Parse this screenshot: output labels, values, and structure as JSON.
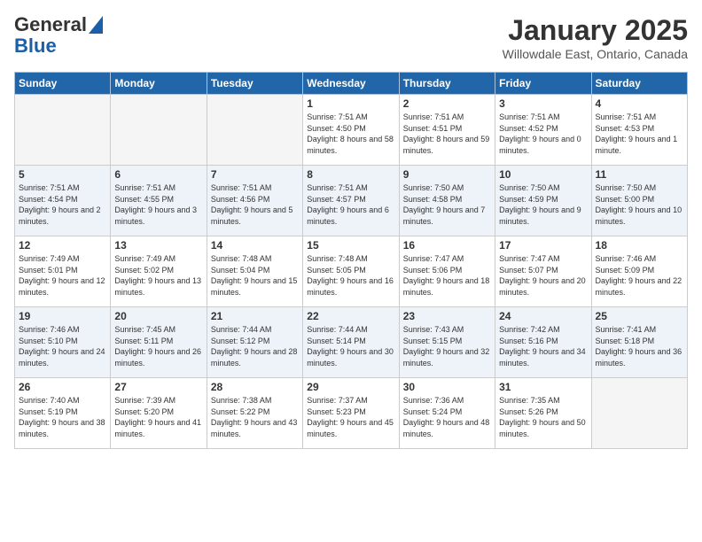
{
  "header": {
    "logo_general": "General",
    "logo_blue": "Blue",
    "month": "January 2025",
    "location": "Willowdale East, Ontario, Canada"
  },
  "days_of_week": [
    "Sunday",
    "Monday",
    "Tuesday",
    "Wednesday",
    "Thursday",
    "Friday",
    "Saturday"
  ],
  "weeks": [
    [
      {
        "day": "",
        "info": ""
      },
      {
        "day": "",
        "info": ""
      },
      {
        "day": "",
        "info": ""
      },
      {
        "day": "1",
        "info": "Sunrise: 7:51 AM\nSunset: 4:50 PM\nDaylight: 8 hours and 58 minutes."
      },
      {
        "day": "2",
        "info": "Sunrise: 7:51 AM\nSunset: 4:51 PM\nDaylight: 8 hours and 59 minutes."
      },
      {
        "day": "3",
        "info": "Sunrise: 7:51 AM\nSunset: 4:52 PM\nDaylight: 9 hours and 0 minutes."
      },
      {
        "day": "4",
        "info": "Sunrise: 7:51 AM\nSunset: 4:53 PM\nDaylight: 9 hours and 1 minute."
      }
    ],
    [
      {
        "day": "5",
        "info": "Sunrise: 7:51 AM\nSunset: 4:54 PM\nDaylight: 9 hours and 2 minutes."
      },
      {
        "day": "6",
        "info": "Sunrise: 7:51 AM\nSunset: 4:55 PM\nDaylight: 9 hours and 3 minutes."
      },
      {
        "day": "7",
        "info": "Sunrise: 7:51 AM\nSunset: 4:56 PM\nDaylight: 9 hours and 5 minutes."
      },
      {
        "day": "8",
        "info": "Sunrise: 7:51 AM\nSunset: 4:57 PM\nDaylight: 9 hours and 6 minutes."
      },
      {
        "day": "9",
        "info": "Sunrise: 7:50 AM\nSunset: 4:58 PM\nDaylight: 9 hours and 7 minutes."
      },
      {
        "day": "10",
        "info": "Sunrise: 7:50 AM\nSunset: 4:59 PM\nDaylight: 9 hours and 9 minutes."
      },
      {
        "day": "11",
        "info": "Sunrise: 7:50 AM\nSunset: 5:00 PM\nDaylight: 9 hours and 10 minutes."
      }
    ],
    [
      {
        "day": "12",
        "info": "Sunrise: 7:49 AM\nSunset: 5:01 PM\nDaylight: 9 hours and 12 minutes."
      },
      {
        "day": "13",
        "info": "Sunrise: 7:49 AM\nSunset: 5:02 PM\nDaylight: 9 hours and 13 minutes."
      },
      {
        "day": "14",
        "info": "Sunrise: 7:48 AM\nSunset: 5:04 PM\nDaylight: 9 hours and 15 minutes."
      },
      {
        "day": "15",
        "info": "Sunrise: 7:48 AM\nSunset: 5:05 PM\nDaylight: 9 hours and 16 minutes."
      },
      {
        "day": "16",
        "info": "Sunrise: 7:47 AM\nSunset: 5:06 PM\nDaylight: 9 hours and 18 minutes."
      },
      {
        "day": "17",
        "info": "Sunrise: 7:47 AM\nSunset: 5:07 PM\nDaylight: 9 hours and 20 minutes."
      },
      {
        "day": "18",
        "info": "Sunrise: 7:46 AM\nSunset: 5:09 PM\nDaylight: 9 hours and 22 minutes."
      }
    ],
    [
      {
        "day": "19",
        "info": "Sunrise: 7:46 AM\nSunset: 5:10 PM\nDaylight: 9 hours and 24 minutes."
      },
      {
        "day": "20",
        "info": "Sunrise: 7:45 AM\nSunset: 5:11 PM\nDaylight: 9 hours and 26 minutes."
      },
      {
        "day": "21",
        "info": "Sunrise: 7:44 AM\nSunset: 5:12 PM\nDaylight: 9 hours and 28 minutes."
      },
      {
        "day": "22",
        "info": "Sunrise: 7:44 AM\nSunset: 5:14 PM\nDaylight: 9 hours and 30 minutes."
      },
      {
        "day": "23",
        "info": "Sunrise: 7:43 AM\nSunset: 5:15 PM\nDaylight: 9 hours and 32 minutes."
      },
      {
        "day": "24",
        "info": "Sunrise: 7:42 AM\nSunset: 5:16 PM\nDaylight: 9 hours and 34 minutes."
      },
      {
        "day": "25",
        "info": "Sunrise: 7:41 AM\nSunset: 5:18 PM\nDaylight: 9 hours and 36 minutes."
      }
    ],
    [
      {
        "day": "26",
        "info": "Sunrise: 7:40 AM\nSunset: 5:19 PM\nDaylight: 9 hours and 38 minutes."
      },
      {
        "day": "27",
        "info": "Sunrise: 7:39 AM\nSunset: 5:20 PM\nDaylight: 9 hours and 41 minutes."
      },
      {
        "day": "28",
        "info": "Sunrise: 7:38 AM\nSunset: 5:22 PM\nDaylight: 9 hours and 43 minutes."
      },
      {
        "day": "29",
        "info": "Sunrise: 7:37 AM\nSunset: 5:23 PM\nDaylight: 9 hours and 45 minutes."
      },
      {
        "day": "30",
        "info": "Sunrise: 7:36 AM\nSunset: 5:24 PM\nDaylight: 9 hours and 48 minutes."
      },
      {
        "day": "31",
        "info": "Sunrise: 7:35 AM\nSunset: 5:26 PM\nDaylight: 9 hours and 50 minutes."
      },
      {
        "day": "",
        "info": ""
      }
    ]
  ]
}
